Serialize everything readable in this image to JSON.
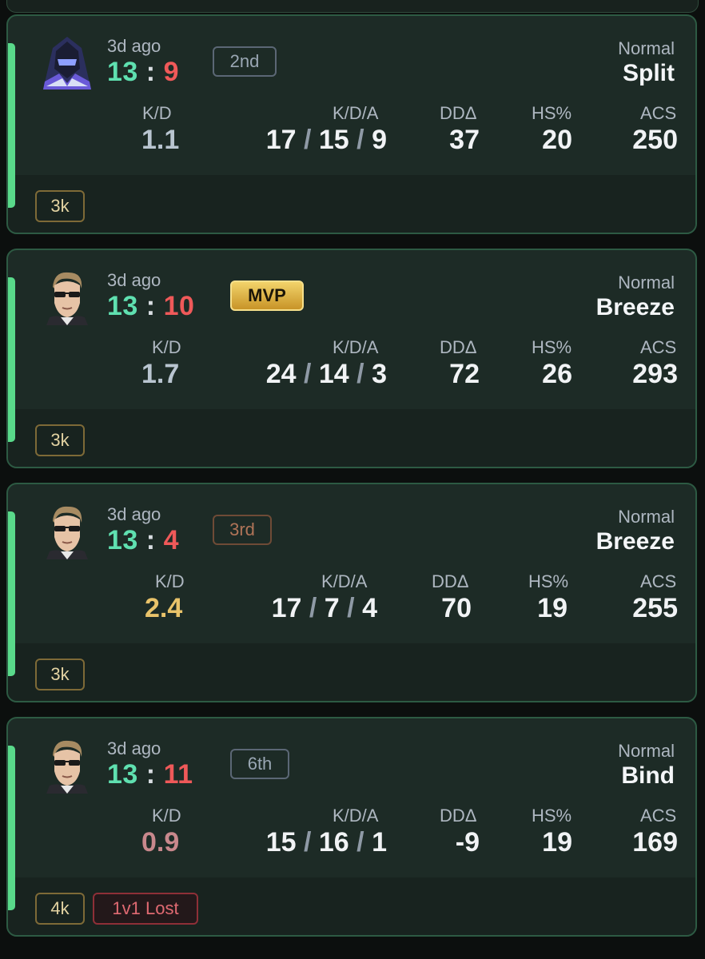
{
  "matches": [
    {
      "ago": "3d ago",
      "score": {
        "won": "13",
        "sep": ":",
        "lost": "9"
      },
      "placement": "2nd",
      "mode": "Normal",
      "map": "Split",
      "labels": {
        "kd": "K/D",
        "kda": "K/D/A",
        "dd": "DDΔ",
        "hs": "HS%",
        "acs": "ACS"
      },
      "kd": "1.1",
      "kda": {
        "k": "17",
        "d": "15",
        "a": "9"
      },
      "dd": "37",
      "hs": "20",
      "acs": "250",
      "tags": [
        "3k"
      ],
      "agent_icon": "agent-portrait-hooded"
    },
    {
      "ago": "3d ago",
      "score": {
        "won": "13",
        "sep": ":",
        "lost": "10"
      },
      "placement": "MVP",
      "mode": "Normal",
      "map": "Breeze",
      "labels": {
        "kd": "K/D",
        "kda": "K/D/A",
        "dd": "DDΔ",
        "hs": "HS%",
        "acs": "ACS"
      },
      "kd": "1.7",
      "kda": {
        "k": "24",
        "d": "14",
        "a": "3"
      },
      "dd": "72",
      "hs": "26",
      "acs": "293",
      "tags": [
        "3k"
      ],
      "agent_icon": "agent-portrait-glasses"
    },
    {
      "ago": "3d ago",
      "score": {
        "won": "13",
        "sep": ":",
        "lost": "4"
      },
      "placement": "3rd",
      "mode": "Normal",
      "map": "Breeze",
      "labels": {
        "kd": "K/D",
        "kda": "K/D/A",
        "dd": "DDΔ",
        "hs": "HS%",
        "acs": "ACS"
      },
      "kd": "2.4",
      "kda": {
        "k": "17",
        "d": "7",
        "a": "4"
      },
      "dd": "70",
      "hs": "19",
      "acs": "255",
      "tags": [
        "3k"
      ],
      "agent_icon": "agent-portrait-glasses"
    },
    {
      "ago": "3d ago",
      "score": {
        "won": "13",
        "sep": ":",
        "lost": "11"
      },
      "placement": "6th",
      "mode": "Normal",
      "map": "Bind",
      "labels": {
        "kd": "K/D",
        "kda": "K/D/A",
        "dd": "DDΔ",
        "hs": "HS%",
        "acs": "ACS"
      },
      "kd": "0.9",
      "kda": {
        "k": "15",
        "d": "16",
        "a": "1"
      },
      "dd": "-9",
      "hs": "19",
      "acs": "169",
      "tags": [
        "4k",
        "1v1 Lost"
      ],
      "agent_icon": "agent-portrait-glasses"
    }
  ],
  "colors": {
    "win": "#5fe0b0",
    "loss": "#ef5959",
    "accent": "#59d98a",
    "card": "#1d2b26",
    "mvp_gold": "#f2d36a"
  }
}
